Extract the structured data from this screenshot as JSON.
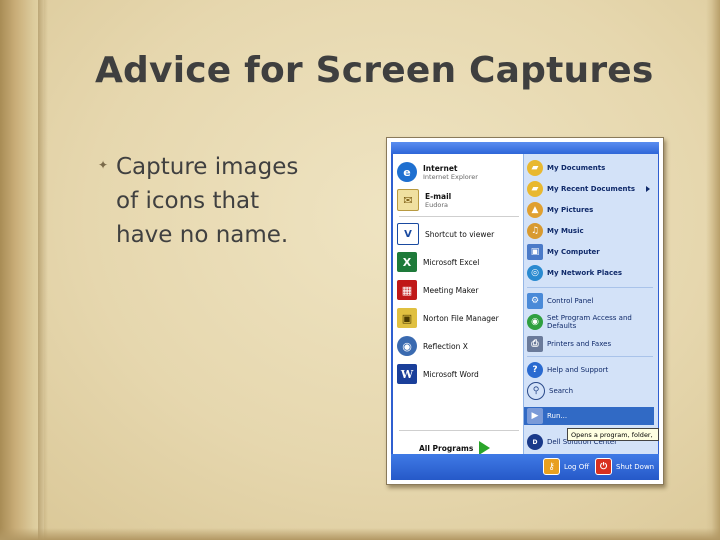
{
  "slide": {
    "title": "Advice for Screen Captures",
    "bullets": [
      {
        "lines": [
          "Capture images",
          "of icons that",
          "have no name."
        ]
      }
    ]
  },
  "start_menu": {
    "pinned": [
      {
        "label": "Internet",
        "sub": "Internet Explorer",
        "icon": "internet-explorer-icon"
      },
      {
        "label": "E-mail",
        "sub": "Eudora",
        "icon": "eudora-icon"
      }
    ],
    "recent": [
      {
        "label": "Shortcut to viewer",
        "icon": "viewer-shortcut-icon"
      },
      {
        "label": "Microsoft Excel",
        "icon": "excel-icon"
      },
      {
        "label": "Meeting Maker",
        "icon": "meeting-maker-icon"
      },
      {
        "label": "Norton File Manager",
        "icon": "norton-file-manager-icon"
      },
      {
        "label": "Reflection X",
        "icon": "reflection-x-icon"
      },
      {
        "label": "Microsoft Word",
        "icon": "word-icon"
      }
    ],
    "all_programs": "All Programs",
    "right_top": [
      {
        "label": "My Documents",
        "icon": "my-documents-icon"
      },
      {
        "label": "My Recent Documents",
        "icon": "recent-documents-icon",
        "has_submenu": true
      },
      {
        "label": "My Pictures",
        "icon": "my-pictures-icon"
      },
      {
        "label": "My Music",
        "icon": "my-music-icon"
      },
      {
        "label": "My Computer",
        "icon": "my-computer-icon"
      },
      {
        "label": "My Network Places",
        "icon": "network-places-icon"
      }
    ],
    "right_mid": [
      {
        "label": "Control Panel",
        "icon": "control-panel-icon"
      },
      {
        "label": "Set Program Access and",
        "label2": "Defaults",
        "icon": "program-access-icon"
      },
      {
        "label": "Printers and Faxes",
        "icon": "printers-icon"
      }
    ],
    "right_bottom": [
      {
        "label": "Help and Support",
        "icon": "help-icon"
      },
      {
        "label": "Search",
        "icon": "search-icon"
      },
      {
        "label": "Run...",
        "icon": "run-icon"
      },
      {
        "label": "Dell Solution Center",
        "icon": "dell-icon"
      }
    ],
    "tooltip": "Opens a program, folder,",
    "log_off": "Log Off",
    "shut_down": "Shut Down",
    "colors": {
      "taskbar_blue": "#2f5fd0",
      "right_pane": "#d3e2f8",
      "highlight": "#316ac5"
    }
  }
}
